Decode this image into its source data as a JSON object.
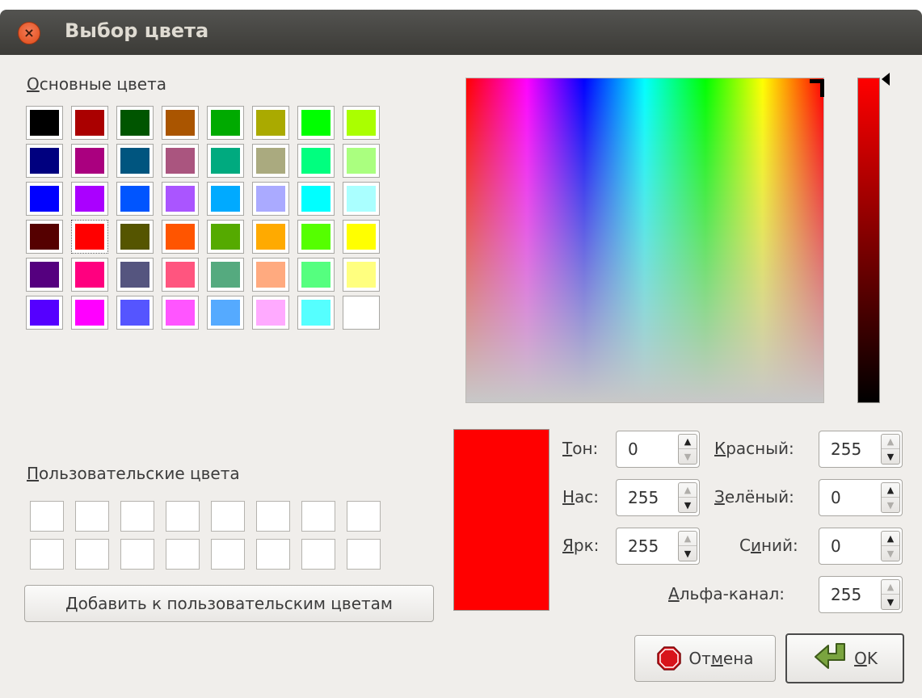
{
  "window": {
    "title": "Выбор цвета",
    "close_icon": "close-icon"
  },
  "basic_colors": {
    "label_u": "О",
    "label_rest": "сновные цвета",
    "rows": [
      [
        "#000000",
        "#aa0000",
        "#005500",
        "#aa5500",
        "#00aa00",
        "#aaaa00",
        "#00ff00",
        "#aaff00"
      ],
      [
        "#00007f",
        "#aa007f",
        "#00557f",
        "#aa557f",
        "#00aa7f",
        "#aaaa7f",
        "#00ff7f",
        "#aaff7f"
      ],
      [
        "#0000ff",
        "#aa00ff",
        "#0055ff",
        "#aa55ff",
        "#00aaff",
        "#aaaaff",
        "#00ffff",
        "#aaffff"
      ],
      [
        "#550000",
        "#ff0000",
        "#555500",
        "#ff5500",
        "#55aa00",
        "#ffaa00",
        "#55ff00",
        "#ffff00"
      ],
      [
        "#55007f",
        "#ff007f",
        "#55557f",
        "#ff557f",
        "#55aa7f",
        "#ffaa7f",
        "#55ff7f",
        "#ffff7f"
      ],
      [
        "#5500ff",
        "#ff00ff",
        "#5555ff",
        "#ff55ff",
        "#55aaff",
        "#ffaaff",
        "#55ffff",
        "#ffffff"
      ]
    ],
    "selected_row": 3,
    "selected_col": 1
  },
  "custom_colors": {
    "label_u": "П",
    "label_rest": "ользовательские цвета",
    "rows": [
      [
        "#ffffff",
        "#ffffff",
        "#ffffff",
        "#ffffff",
        "#ffffff",
        "#ffffff",
        "#ffffff",
        "#ffffff"
      ],
      [
        "#ffffff",
        "#ffffff",
        "#ffffff",
        "#ffffff",
        "#ffffff",
        "#ffffff",
        "#ffffff",
        "#ffffff"
      ]
    ],
    "add_button_u": "Д",
    "add_button_rest": "обавить к пользовательским цветам"
  },
  "preview_color": "#ff0000",
  "fields": {
    "hue": {
      "label_u": "Т",
      "label_rest": "он:",
      "value": "0"
    },
    "sat": {
      "label_u": "Н",
      "label_rest": "ас:",
      "value": "255"
    },
    "val": {
      "label_u": "Я",
      "label_rest": "рк:",
      "value": "255"
    },
    "red": {
      "label_u": "К",
      "label_rest": "расный:",
      "value": "255"
    },
    "green": {
      "label_u": "З",
      "label_rest": "елёный:",
      "value": "0"
    },
    "blue": {
      "label_pre": "С",
      "label_u": "и",
      "label_rest": "ний:",
      "value": "0"
    },
    "alpha": {
      "label_u": "А",
      "label_rest": "льфа-канал:",
      "value": "255"
    }
  },
  "buttons": {
    "cancel_pre": "От",
    "cancel_u": "м",
    "cancel_rest": "ена",
    "cancel_icon": "stop-icon",
    "ok_u": "O",
    "ok_rest": "K",
    "ok_icon": "back-arrow-icon"
  }
}
